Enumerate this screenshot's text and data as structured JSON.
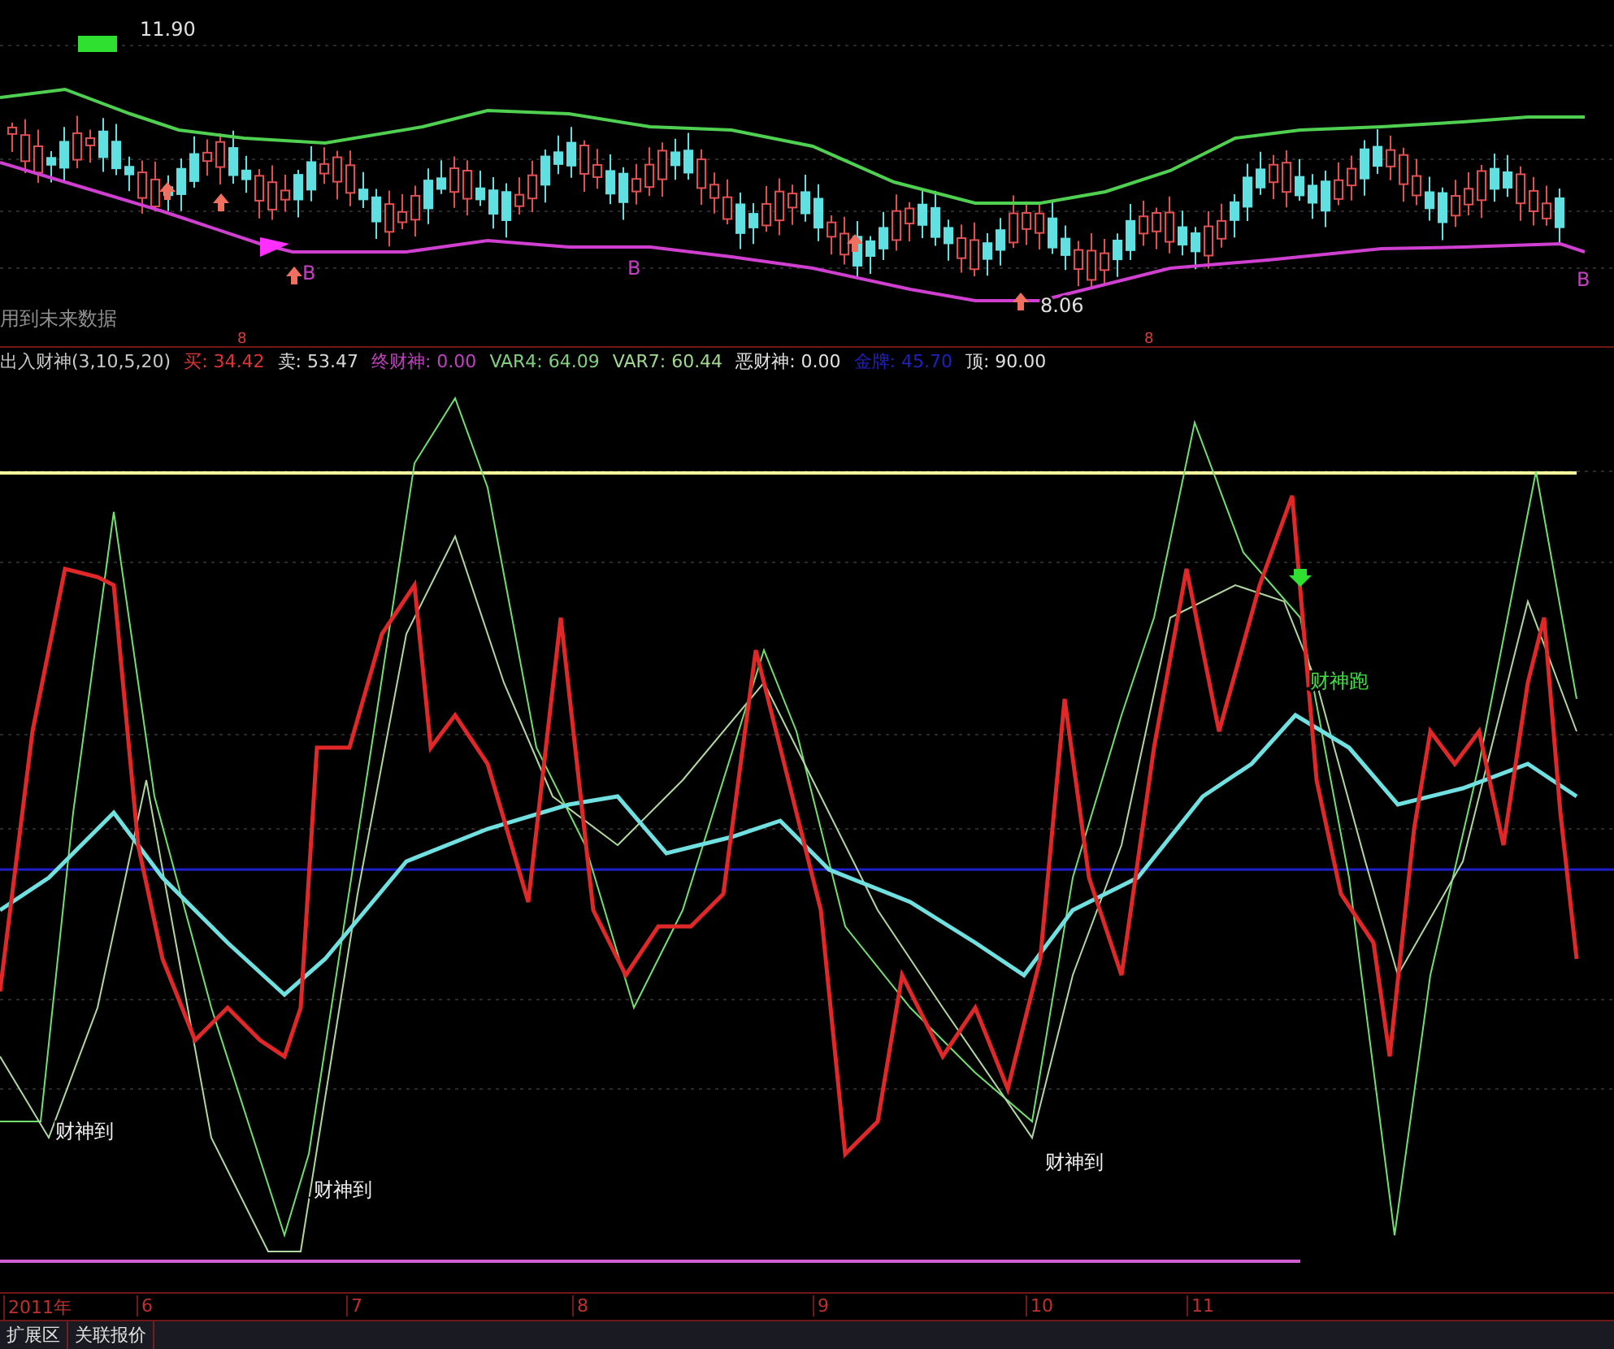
{
  "price_panel": {
    "high_label": "11.90",
    "low_label": "8.06",
    "signals": [
      "B",
      "B",
      "B"
    ],
    "note": "用到未来数据",
    "markers": [
      "8",
      "8"
    ]
  },
  "indicator_legend": [
    {
      "text": "出入财神(3,10,5,20)",
      "color": "#c8c8c8"
    },
    {
      "text": "买: 34.42",
      "color": "#e03434"
    },
    {
      "text": "卖: 53.47",
      "color": "#d8d8d8"
    },
    {
      "text": "终财神: 0.00",
      "color": "#c040c0"
    },
    {
      "text": "VAR4: 64.09",
      "color": "#80d080"
    },
    {
      "text": "VAR7: 60.44",
      "color": "#a0d890"
    },
    {
      "text": "恶财神: 0.00",
      "color": "#e0e0e0"
    },
    {
      "text": "金牌: 45.70",
      "color": "#2020c0"
    },
    {
      "text": "顶: 90.00",
      "color": "#e0e0e0"
    }
  ],
  "indicator_panel": {
    "labels": [
      {
        "kind": "buy",
        "text": "财神到"
      },
      {
        "kind": "buy",
        "text": "财神到"
      },
      {
        "kind": "buy",
        "text": "财神到"
      },
      {
        "kind": "sell",
        "text": "财神跑"
      }
    ]
  },
  "time_axis": [
    "2011年",
    "6",
    "7",
    "8",
    "9",
    "10",
    "11"
  ],
  "bottom_tabs": [
    {
      "label": "扩展区",
      "selected": false
    },
    {
      "label": "关联报价",
      "selected": false
    }
  ]
}
